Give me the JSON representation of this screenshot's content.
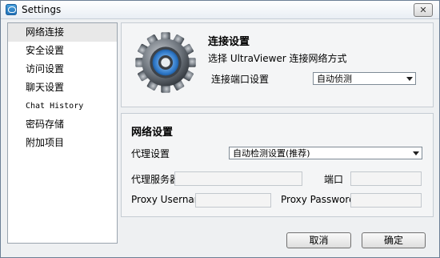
{
  "window": {
    "title": "Settings",
    "close_glyph": "✕"
  },
  "sidebar": {
    "items": [
      {
        "label": "网络连接"
      },
      {
        "label": "安全设置"
      },
      {
        "label": "访问设置"
      },
      {
        "label": "聊天设置"
      },
      {
        "label": "Chat History"
      },
      {
        "label": "密码存储"
      },
      {
        "label": "附加项目"
      }
    ],
    "selected_index": 0
  },
  "connection": {
    "title": "连接设置",
    "description": "选择 UltraViewer 连接网络方式",
    "port_label": "连接端口设置",
    "port_value": "自动侦测",
    "icon": "gear-icon"
  },
  "network": {
    "title": "网络设置",
    "proxy_label": "代理设置",
    "proxy_value": "自动检测设置(推荐)",
    "proxy_server_label": "代理服务器",
    "proxy_server_value": "",
    "port_label": "端口",
    "port_value": "",
    "username_label": "Proxy Username",
    "username_value": "",
    "password_label": "Proxy Password",
    "password_value": ""
  },
  "buttons": {
    "cancel": "取消",
    "ok": "确定"
  },
  "colors": {
    "selection": "#e8e8e8",
    "accent": "#1f6fb5"
  }
}
